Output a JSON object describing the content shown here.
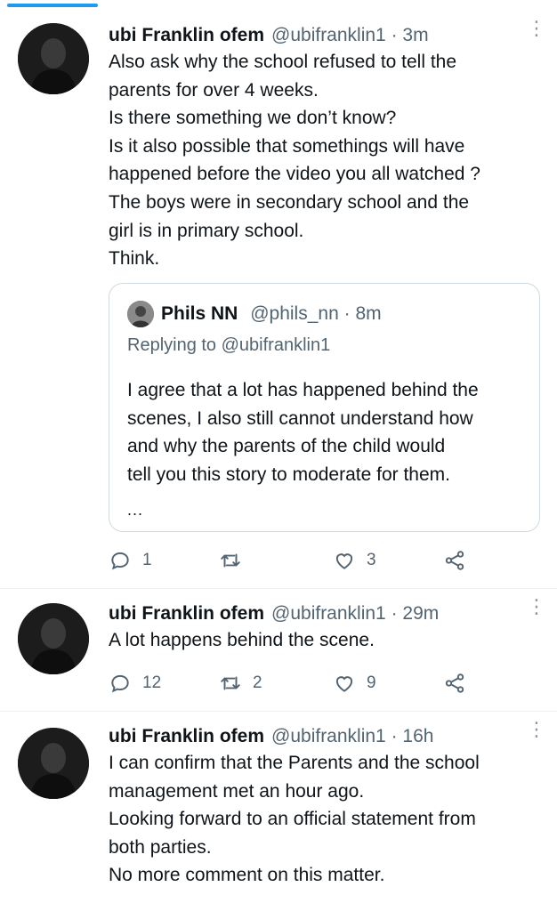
{
  "tweets": [
    {
      "name": "ubi Franklin ofem",
      "handle": "@ubifranklin1",
      "sep": "·",
      "time": "3m",
      "lines": [
        "Also ask why the school refused to tell the",
        "parents for over 4 weeks.",
        "Is there something we don’t know?",
        "Is it also possible that somethings will have",
        "happened before the video you all watched ?",
        "The boys were in secondary school and the",
        "girl is in primary school.",
        "Think."
      ],
      "quote": {
        "name": "Phils NN",
        "handle": "@phils_nn",
        "sep": "·",
        "time": "8m",
        "replying_prefix": "Replying to",
        "replying_to": "@ubifranklin1",
        "lines": [
          "I agree that a lot has happened behind the",
          "scenes, I also still cannot understand how",
          "and why the parents of the child would",
          "tell you this story to moderate for them."
        ],
        "ellipsis": "..."
      },
      "replies": "1",
      "retweets": "",
      "likes": "3"
    },
    {
      "name": "ubi Franklin ofem",
      "handle": "@ubifranklin1",
      "sep": "·",
      "time": "29m",
      "lines": [
        "A lot happens behind the scene."
      ],
      "replies": "12",
      "retweets": "2",
      "likes": "9"
    },
    {
      "name": "ubi Franklin ofem",
      "handle": "@ubifranklin1",
      "sep": "·",
      "time": "16h",
      "lines": [
        "I can confirm that the Parents and the school",
        "management met an hour ago.",
        "Looking forward to an official statement from",
        "both parties.",
        "No more comment on this matter."
      ]
    }
  ],
  "icons": {
    "reply": "reply-icon",
    "retweet": "retweet-icon",
    "like": "heart-icon",
    "share": "share-icon",
    "more": "more-vertical-icon"
  },
  "colors": {
    "accent": "#1d9bf0",
    "text": "#0f1419",
    "secondary": "#536471",
    "border": "#cfd9de"
  }
}
